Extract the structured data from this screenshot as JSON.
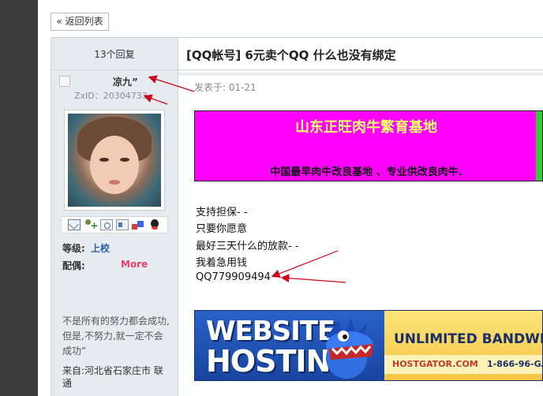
{
  "nav": {
    "back_label": "« 返回列表"
  },
  "sidebar": {
    "reply_count": "13个回复",
    "username": "凉九”",
    "zxid": "ZxID：20304733",
    "fields": {
      "level_label": "等级:",
      "level_value": "上校",
      "spouse_label": "配偶:",
      "spouse_more": "More"
    },
    "signature": "不是所有的努力都会成功,但是,不努力,就一定不会成功”",
    "location": "来自:河北省石家庄市 联通",
    "profile_icons": [
      "mail-icon",
      "add-friend-icon",
      "search-doc-icon",
      "profile-card-icon",
      "blocks-icon",
      "qq-icon"
    ]
  },
  "post": {
    "title": "[QQ帐号] 6元卖个QQ  什么也没有绑定",
    "date": "发表于: 01-21",
    "lines": [
      "支持担保- -",
      "只要你愿意",
      "最好三天什么的放款- -",
      "我着急用钱",
      "QQ779909494"
    ]
  },
  "ad1": {
    "headline": "山东正旺肉牛繁育基地",
    "tagline": "中国最早肉牛改良基地 、专业供改良肉牛."
  },
  "ad2": {
    "word1": "WEBSITE",
    "word2": "HOSTING",
    "headline": "UNLIMITED BANDWIDT",
    "site": "HOSTGATOR.COM",
    "phone": "1-866-96-GA"
  },
  "colors": {
    "annotation_arrow": "#d0021b",
    "ad1_background": "#ff00ff",
    "ad1_headline": "#ffff66",
    "link_blue": "#2a5dab",
    "more_pink": "#e8416c"
  }
}
